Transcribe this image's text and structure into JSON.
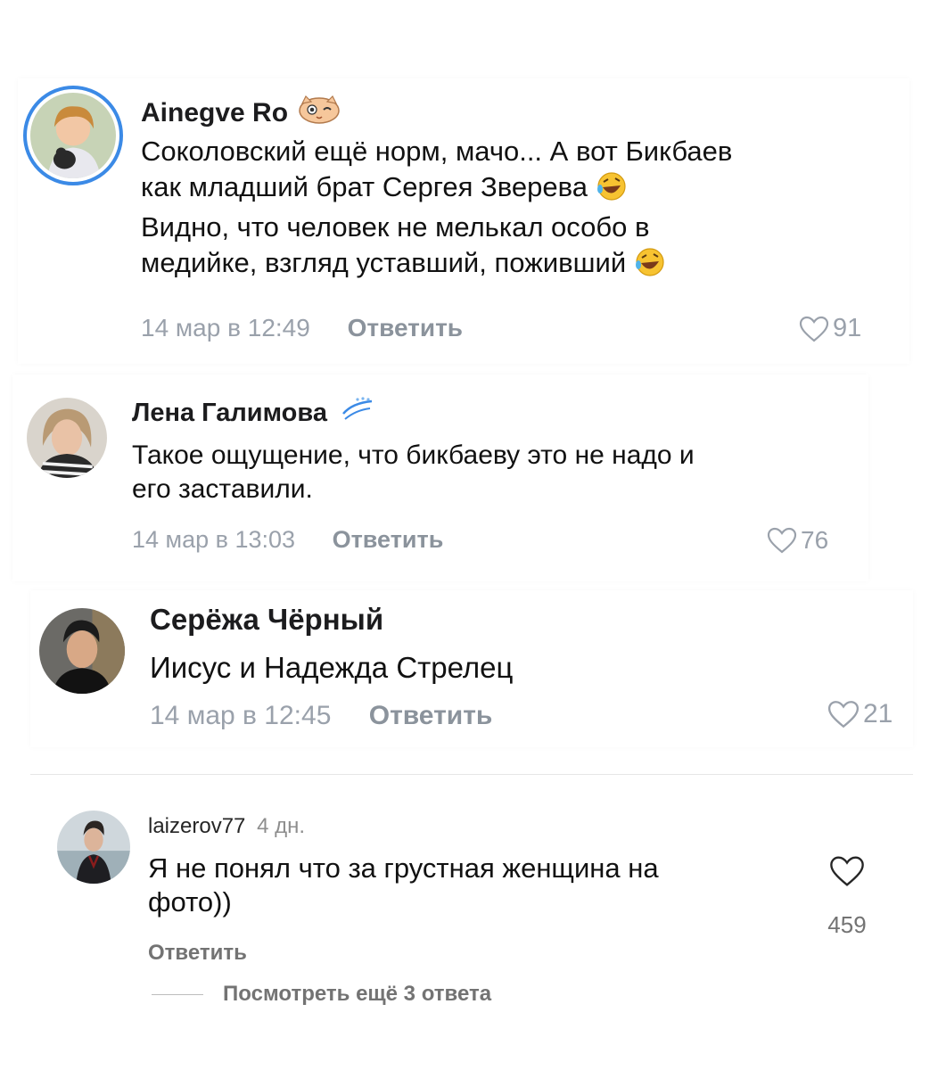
{
  "comments": [
    {
      "author": "Ainegve Ro",
      "text_lines": [
        "Соколовский ещё норм, мачо... А вот Бикбаев",
        "как младший брат Сергея Зверева",
        "Видно, что человек не мелькал особо в",
        "медийке, взгляд уставший, поживший"
      ],
      "date": "14 мар в 12:49",
      "reply": "Ответить",
      "likes": "91",
      "badge_icon": "cat-wink-emoji-icon",
      "inline_emoji": "rolling-laughing-emoji-icon"
    },
    {
      "author": "Лена Галимова",
      "text_lines": [
        "Такое ощущение, что бикбаеву это не надо и",
        "его заставили."
      ],
      "date": "14 мар в 13:03",
      "reply": "Ответить",
      "likes": "76",
      "badge_icon": "zenit-logo-icon"
    },
    {
      "author": "Серёжа Чёрный",
      "text_lines": [
        "Иисус и Надежда Стрелец"
      ],
      "date": "14 мар в 12:45",
      "reply": "Ответить",
      "likes": "21"
    },
    {
      "author": "laizerov77",
      "age": "4 дн.",
      "text_lines": [
        "Я не понял что за грустная женщина на",
        "фото))"
      ],
      "reply": "Ответить",
      "likes": "459",
      "view_more": "Посмотреть ещё 3 ответа"
    }
  ],
  "colors": {
    "meta_gray": "#9aa1ab",
    "reply_gray": "#8b939c",
    "avatar_ring": "#3b8ae6"
  }
}
